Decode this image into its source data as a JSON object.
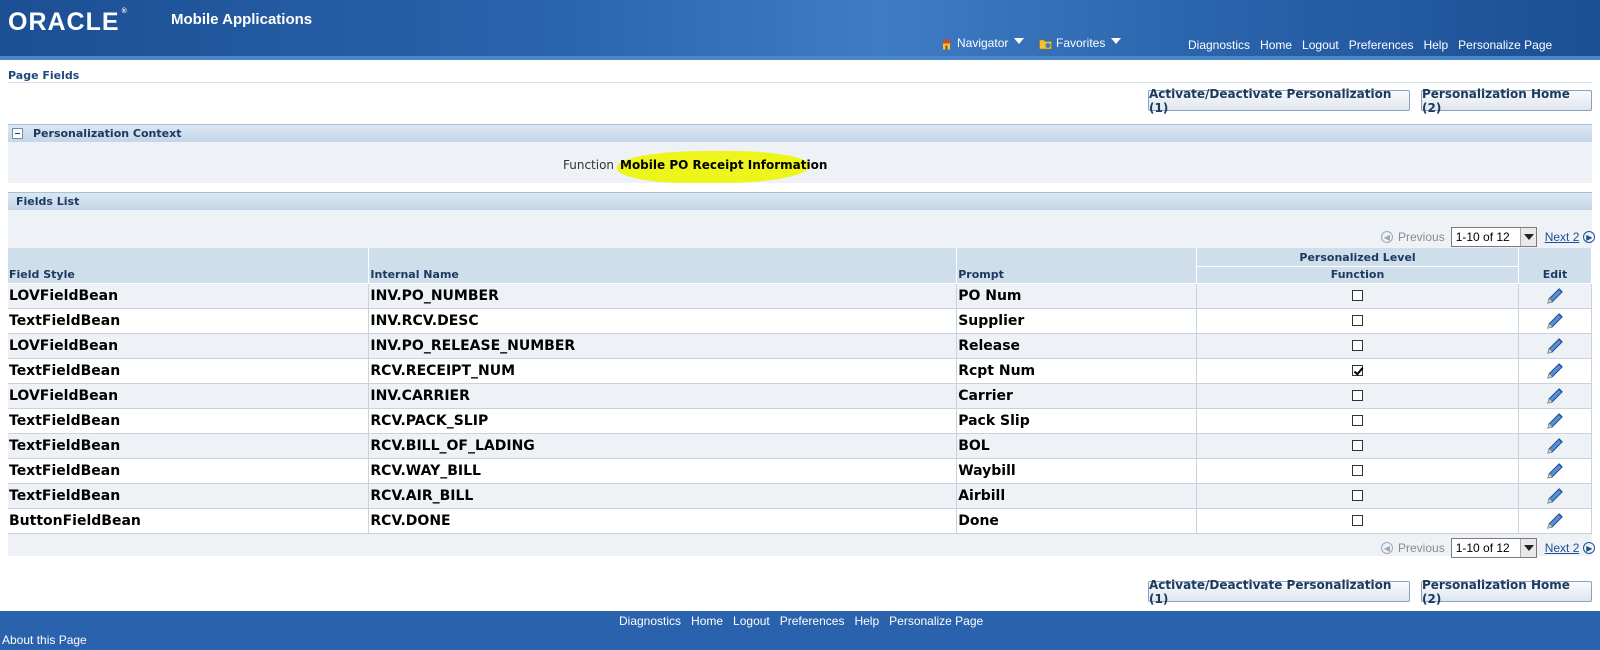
{
  "header": {
    "logo": "ORACLE",
    "app_title": "Mobile Applications",
    "navigator": "Navigator",
    "favorites": "Favorites",
    "links": [
      "Diagnostics",
      "Home",
      "Logout",
      "Preferences",
      "Help",
      "Personalize Page"
    ]
  },
  "page": {
    "title": "Page Fields"
  },
  "buttons": {
    "activate": "Activate/Deactivate Personalization (1)",
    "home": "Personalization Home (2)"
  },
  "context": {
    "header": "Personalization Context",
    "function_label": "Function",
    "function_value": "Mobile PO Receipt Information"
  },
  "fields_list": {
    "header": "Fields List",
    "nav": {
      "previous": "Previous",
      "range": "1-10 of 12",
      "next": "Next 2"
    },
    "columns": {
      "field_style": "Field Style",
      "internal_name": "Internal Name",
      "prompt": "Prompt",
      "personalized_level": "Personalized Level",
      "function": "Function",
      "edit": "Edit"
    },
    "rows": [
      {
        "style": "LOVFieldBean",
        "name": "INV.PO_NUMBER",
        "prompt": "PO Num",
        "checked": false
      },
      {
        "style": "TextFieldBean",
        "name": "INV.RCV.DESC",
        "prompt": "Supplier",
        "checked": false
      },
      {
        "style": "LOVFieldBean",
        "name": "INV.PO_RELEASE_NUMBER",
        "prompt": "Release",
        "checked": false
      },
      {
        "style": "TextFieldBean",
        "name": "RCV.RECEIPT_NUM",
        "prompt": "Rcpt Num",
        "checked": true
      },
      {
        "style": "LOVFieldBean",
        "name": "INV.CARRIER",
        "prompt": "Carrier",
        "checked": false
      },
      {
        "style": "TextFieldBean",
        "name": "RCV.PACK_SLIP",
        "prompt": "Pack Slip",
        "checked": false
      },
      {
        "style": "TextFieldBean",
        "name": "RCV.BILL_OF_LADING",
        "prompt": "BOL",
        "checked": false
      },
      {
        "style": "TextFieldBean",
        "name": "RCV.WAY_BILL",
        "prompt": "Waybill",
        "checked": false
      },
      {
        "style": "TextFieldBean",
        "name": "RCV.AIR_BILL",
        "prompt": "Airbill",
        "checked": false
      },
      {
        "style": "ButtonFieldBean",
        "name": "RCV.DONE",
        "prompt": "Done",
        "checked": false
      }
    ]
  },
  "footer": {
    "links": [
      "Diagnostics",
      "Home",
      "Logout",
      "Preferences",
      "Help",
      "Personalize Page"
    ],
    "about": "About this Page"
  },
  "colors": {
    "header_blue": "#2a64ad",
    "section_header": "#cfdeeb",
    "highlight_yellow": "#eef51a",
    "footer_blue": "#2a62ad"
  },
  "icons": [
    "home-icon",
    "favorites-folder-icon",
    "collapse-icon",
    "previous-arrow-icon",
    "next-arrow-icon",
    "pencil-edit-icon",
    "dropdown-arrow-icon"
  ]
}
